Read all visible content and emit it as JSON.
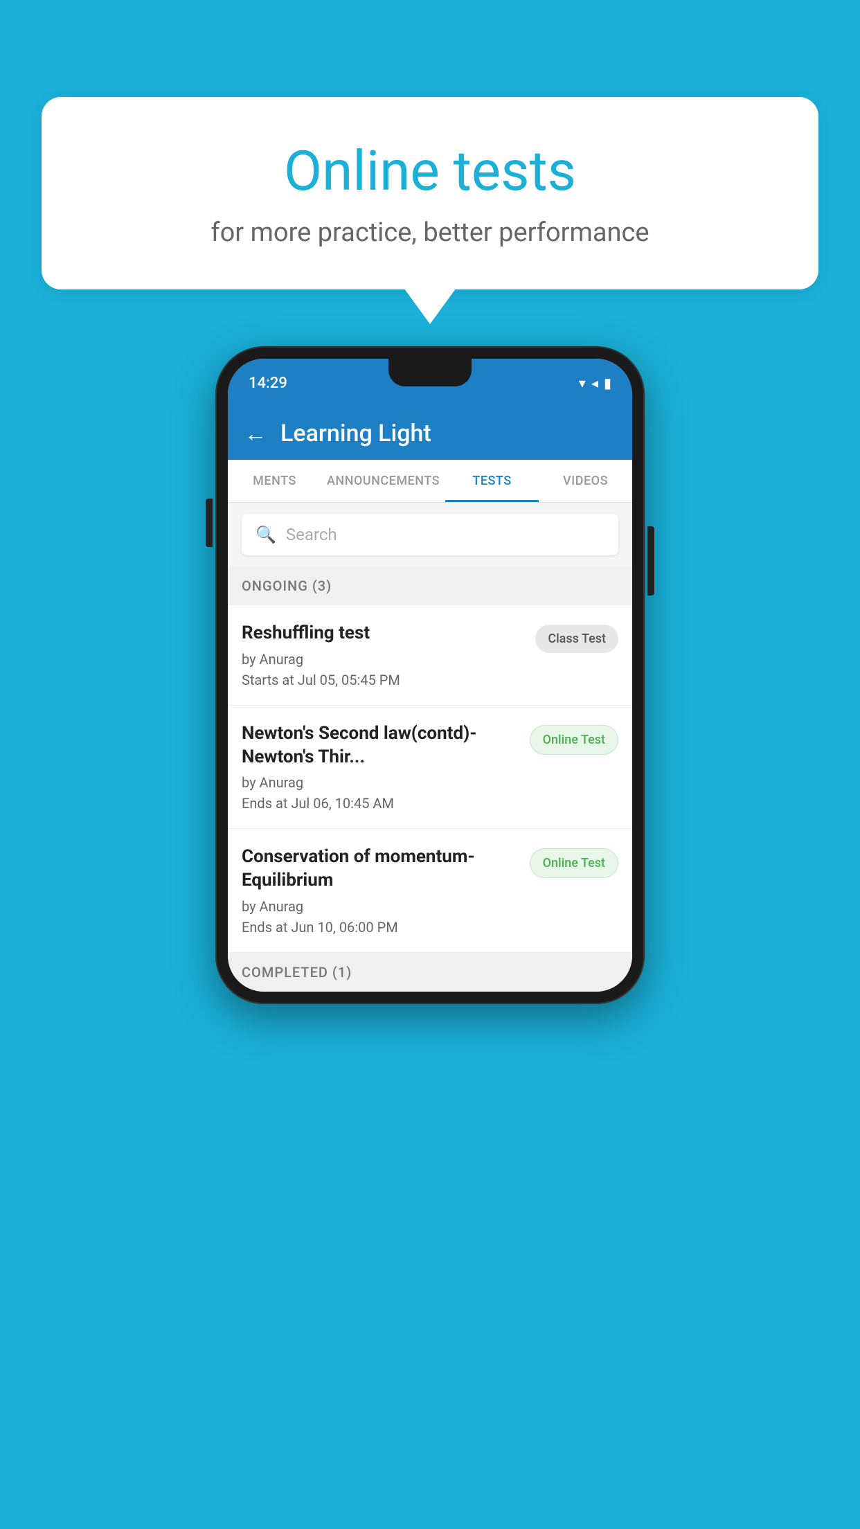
{
  "background": {
    "color": "#1ab0d8"
  },
  "speech_bubble": {
    "title": "Online tests",
    "subtitle": "for more practice, better performance"
  },
  "phone": {
    "status_bar": {
      "time": "14:29",
      "icons": [
        "wifi",
        "signal",
        "battery"
      ]
    },
    "app_header": {
      "back_label": "←",
      "title": "Learning Light"
    },
    "tabs": [
      {
        "label": "MENTS",
        "active": false
      },
      {
        "label": "ANNOUNCEMENTS",
        "active": false
      },
      {
        "label": "TESTS",
        "active": true
      },
      {
        "label": "VIDEOS",
        "active": false
      }
    ],
    "search": {
      "placeholder": "Search"
    },
    "sections": [
      {
        "title": "ONGOING (3)",
        "items": [
          {
            "name": "Reshuffling test",
            "author": "by Anurag",
            "time_label": "Starts at",
            "time_value": "Jul 05, 05:45 PM",
            "badge": "Class Test",
            "badge_type": "class"
          },
          {
            "name": "Newton's Second law(contd)-Newton's Thir...",
            "author": "by Anurag",
            "time_label": "Ends at",
            "time_value": "Jul 06, 10:45 AM",
            "badge": "Online Test",
            "badge_type": "online"
          },
          {
            "name": "Conservation of momentum-Equilibrium",
            "author": "by Anurag",
            "time_label": "Ends at",
            "time_value": "Jun 10, 06:00 PM",
            "badge": "Online Test",
            "badge_type": "online"
          }
        ]
      },
      {
        "title": "COMPLETED (1)",
        "items": []
      }
    ]
  }
}
